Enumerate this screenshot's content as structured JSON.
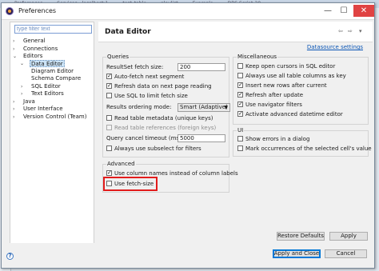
{
  "background_tabs": [
    "Preferences",
    "Services - localhost:1",
    "test_table",
    "playlist",
    "Example",
    "DBS Script-20"
  ],
  "window": {
    "title": "Preferences",
    "controls": {
      "minimize": "—",
      "maximize": "☐",
      "close": "✕"
    }
  },
  "sidebar": {
    "filter_placeholder": "type filter text",
    "items": [
      {
        "label": "General",
        "arrow": "›"
      },
      {
        "label": "Connections",
        "arrow": "›"
      },
      {
        "label": "Editors",
        "arrow": "⌄"
      },
      {
        "label": "Data Editor",
        "arrow": "⌄"
      },
      {
        "label": "Diagram Editor"
      },
      {
        "label": "Schema Compare"
      },
      {
        "label": "SQL Editor",
        "arrow": "›"
      },
      {
        "label": "Text Editors",
        "arrow": "›"
      },
      {
        "label": "Java",
        "arrow": "›"
      },
      {
        "label": "User Interface",
        "arrow": "›"
      },
      {
        "label": "Version Control (Team)",
        "arrow": "›"
      }
    ]
  },
  "page": {
    "title": "Data Editor",
    "nav": {
      "back": "⇦",
      "forward": "⇨",
      "menu": "▾"
    },
    "datasource_link": "Datasource settings"
  },
  "queries": {
    "legend": "Queries",
    "fetch_size_label": "ResultSet fetch size:",
    "fetch_size_value": "200",
    "auto_fetch": "Auto-fetch next segment",
    "refresh_next_page": "Refresh data on next page reading",
    "use_sql_limit": "Use SQL to limit fetch size",
    "ordering_label": "Results ordering mode:",
    "ordering_value": "Smart (Adaptive)",
    "read_table_metadata": "Read table metadata (unique keys)",
    "read_table_references": "Read table references (foreign keys)",
    "timeout_label": "Query cancel timeout (ms):",
    "timeout_value": "5000",
    "always_subselect": "Always use subselect for filters"
  },
  "advanced": {
    "legend": "Advanced",
    "use_column_names": "Use column names instead of column labels",
    "use_fetch_size": "Use fetch-size"
  },
  "misc": {
    "legend": "Miscellaneous",
    "keep_cursors": "Keep open cursors in SQL editor",
    "always_use_all_columns": "Always use all table columns as key",
    "insert_new_rows": "Insert new rows after current",
    "refresh_after_update": "Refresh after update",
    "use_navigator_filters": "Use navigator filters",
    "activate_datetime_editor": "Activate advanced datetime editor"
  },
  "ui": {
    "legend": "UI",
    "show_errors": "Show errors in a dialog",
    "mark_occurrences": "Mark occurrences of the selected cell's value"
  },
  "checks": {
    "auto_fetch": true,
    "refresh_next_page": true,
    "use_sql_limit": false,
    "read_table_metadata": false,
    "read_table_references": false,
    "always_subselect": false,
    "use_column_names": true,
    "use_fetch_size": false,
    "keep_cursors": false,
    "always_use_all_columns": false,
    "insert_new_rows": true,
    "refresh_after_update": true,
    "use_navigator_filters": true,
    "activate_datetime_editor": true,
    "show_errors": false,
    "mark_occurrences": false
  },
  "check_mark": "✓",
  "buttons": {
    "restore_defaults": "Restore Defaults",
    "apply": "Apply",
    "apply_and_close": "Apply and Close",
    "cancel": "Cancel"
  },
  "help_icon": "?",
  "colors": {
    "highlight": "#e21c1c",
    "link": "#0b56b5",
    "selection": "#cce4f7"
  }
}
